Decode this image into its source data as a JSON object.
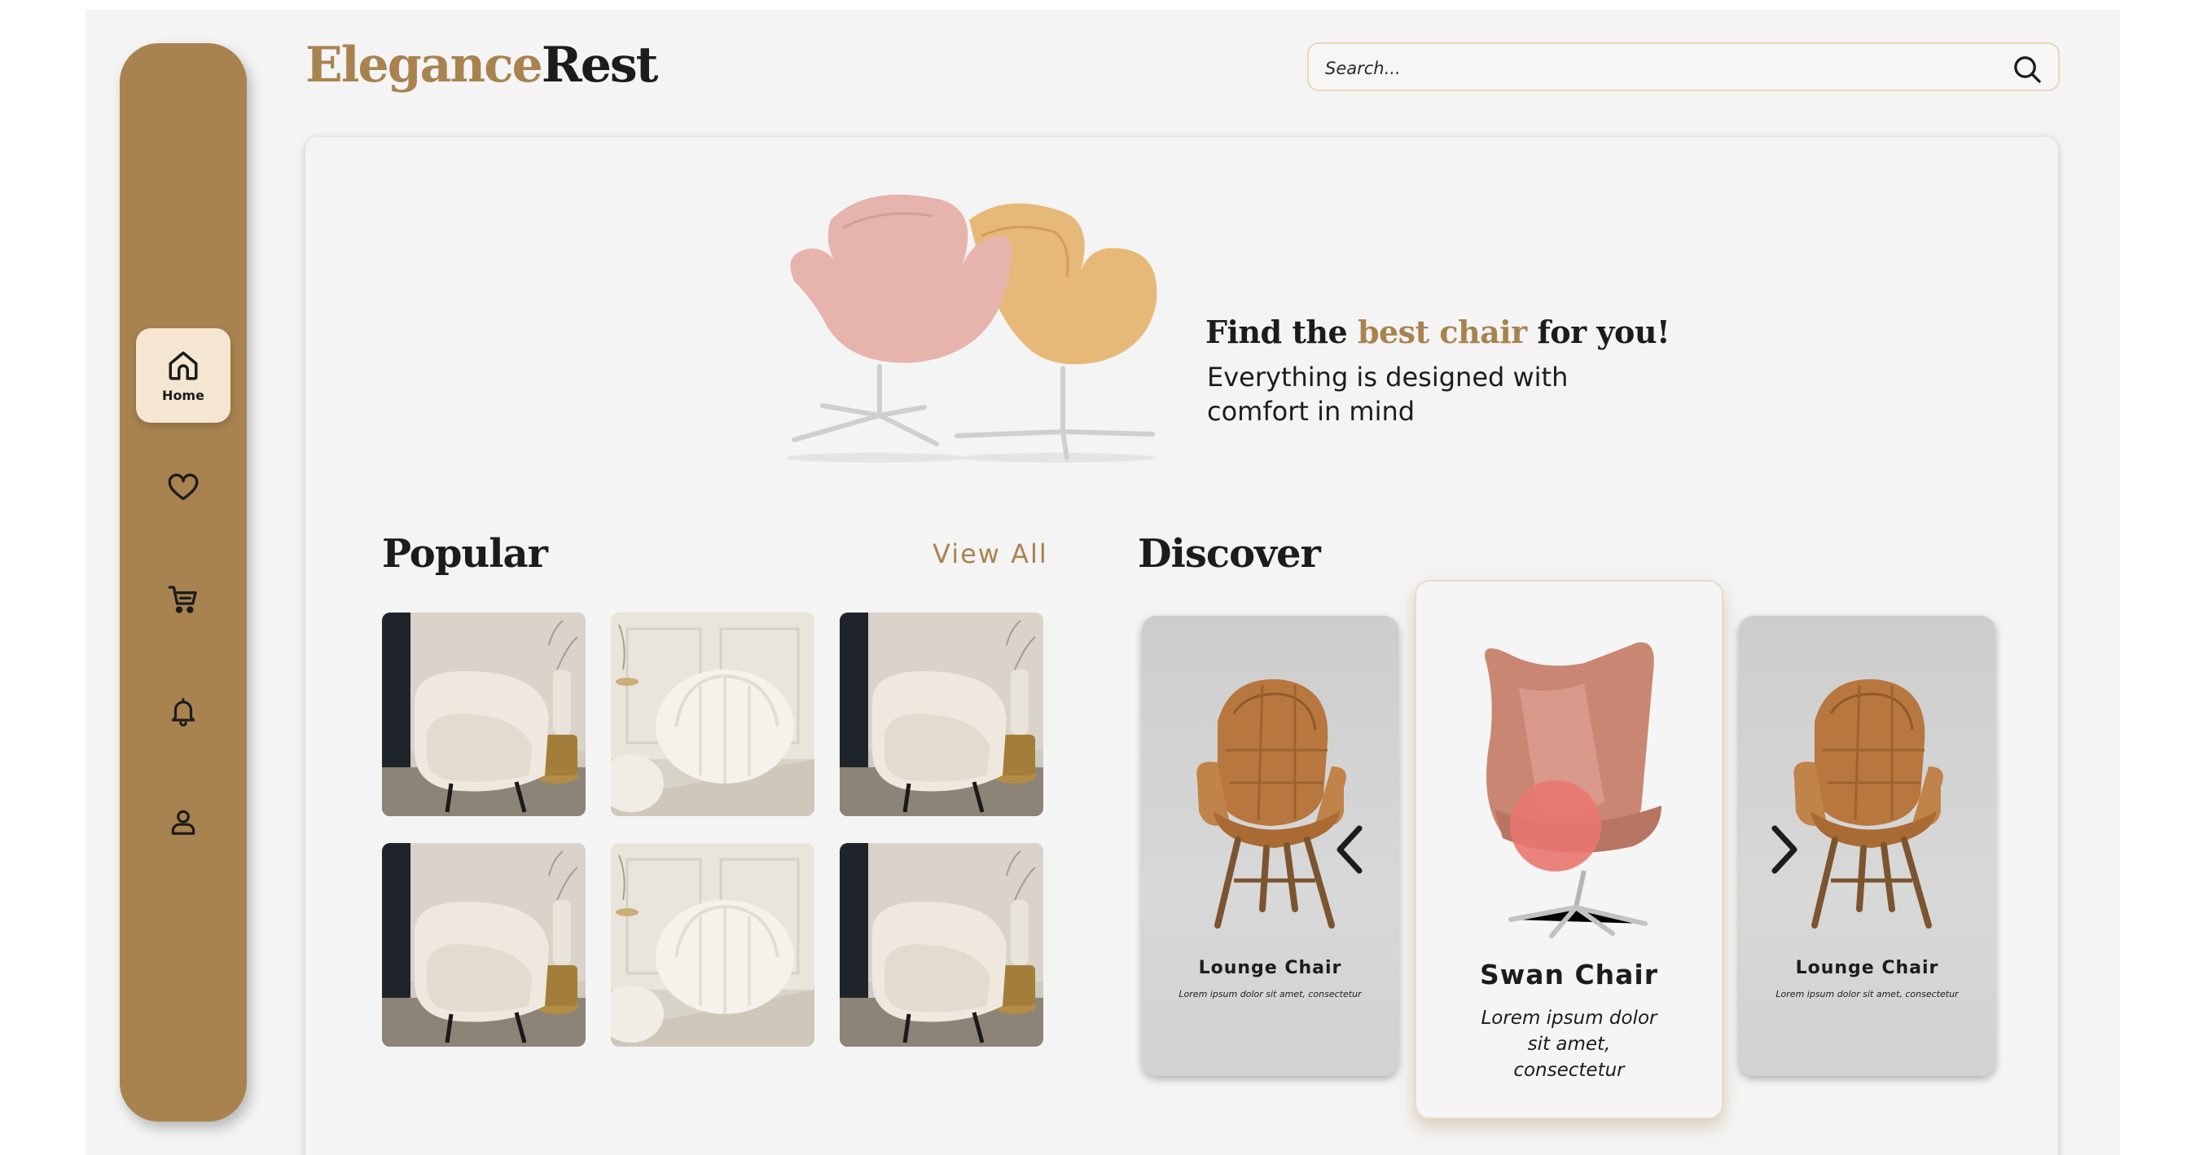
{
  "brand": {
    "part1": "Elegance",
    "part2": "Rest",
    "accent_color": "#a8834f",
    "dark_color": "#1c1c1c"
  },
  "search": {
    "placeholder": "Search...",
    "icon": "search-icon"
  },
  "sidebar": {
    "items": [
      {
        "label": "Home",
        "icon": "home-icon",
        "active": true
      },
      {
        "label": "",
        "icon": "heart-icon"
      },
      {
        "label": "",
        "icon": "cart-icon"
      },
      {
        "label": "",
        "icon": "bell-icon"
      },
      {
        "label": "",
        "icon": "user-icon"
      }
    ]
  },
  "hero": {
    "title_pre": "Find the ",
    "title_highlight": "best chair",
    "title_post": " for you!",
    "subtitle": "Everything is designed with comfort in mind"
  },
  "popular": {
    "title": "Popular",
    "view_all": "View All"
  },
  "discover": {
    "title": "Discover",
    "cards": [
      {
        "name": "Lounge Chair",
        "desc": "Lorem ipsum dolor sit amet, consectetur"
      },
      {
        "name": "Swan Chair",
        "desc": "Lorem ipsum dolor sit amet, consectetur"
      },
      {
        "name": "Lounge Chair",
        "desc": "Lorem ipsum dolor sit amet, consectetur"
      }
    ]
  }
}
